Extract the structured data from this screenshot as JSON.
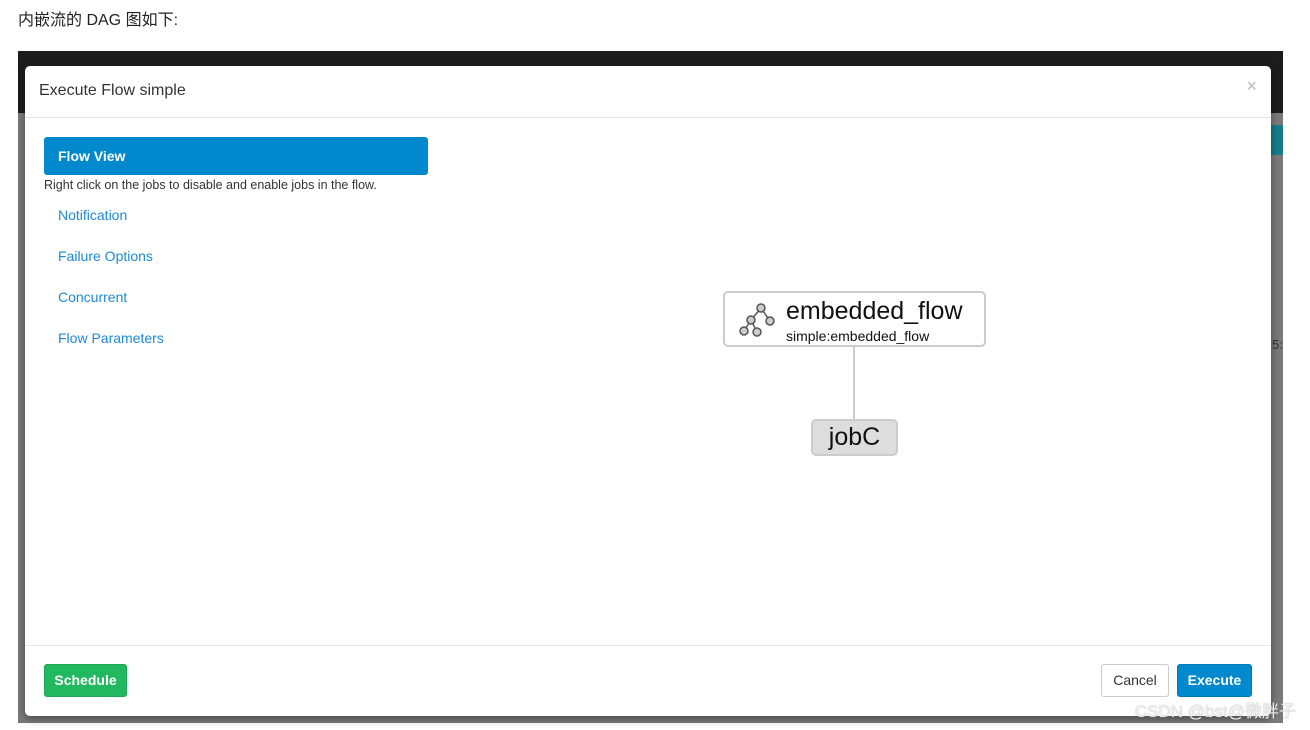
{
  "caption": "内嵌流的 DAG 图如下:",
  "background": {
    "partial_text": "5:"
  },
  "modal": {
    "title": "Execute Flow simple",
    "close_label": "×",
    "sidebar": {
      "active": "Flow View",
      "hint": "Right click on the jobs to disable and enable jobs in the flow.",
      "items": [
        {
          "label": "Notification"
        },
        {
          "label": "Failure Options"
        },
        {
          "label": "Concurrent"
        },
        {
          "label": "Flow Parameters"
        }
      ]
    },
    "graph": {
      "flow_node": {
        "name": "embedded_flow",
        "sub": "simple:embedded_flow",
        "icon": "flow-tree-icon"
      },
      "job_node": {
        "name": "jobC"
      }
    },
    "footer": {
      "schedule": "Schedule",
      "cancel": "Cancel",
      "execute": "Execute"
    }
  },
  "watermark": "CSDN @bst@微胖子",
  "colors": {
    "primary": "#0089cc",
    "success": "#22b85f",
    "link": "#1e8ad2"
  }
}
